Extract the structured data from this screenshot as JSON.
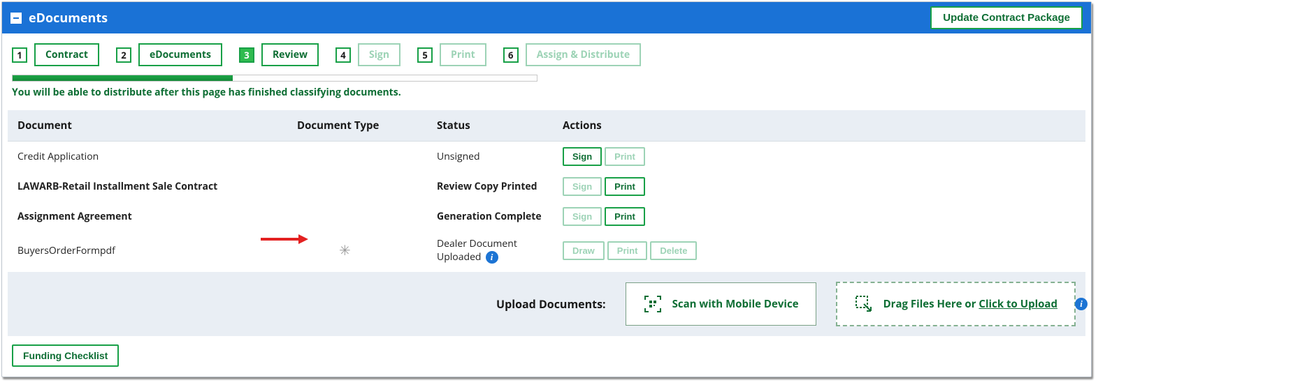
{
  "header": {
    "title": "eDocuments",
    "update_btn": "Update Contract Package"
  },
  "steps": [
    {
      "num": "1",
      "label": "Contract",
      "active": false,
      "faded": false
    },
    {
      "num": "2",
      "label": "eDocuments",
      "active": false,
      "faded": false
    },
    {
      "num": "3",
      "label": "Review",
      "active": true,
      "faded": false
    },
    {
      "num": "4",
      "label": "Sign",
      "active": false,
      "faded": true
    },
    {
      "num": "5",
      "label": "Print",
      "active": false,
      "faded": true
    },
    {
      "num": "6",
      "label": "Assign & Distribute",
      "active": false,
      "faded": true
    }
  ],
  "progress": {
    "percent": 42,
    "note": "You will be able to distribute after this page has finished classifying documents."
  },
  "table": {
    "headers": {
      "document": "Document",
      "doctype": "Document Type",
      "status": "Status",
      "actions": "Actions"
    },
    "rows": [
      {
        "name": "Credit Application",
        "name_bold": false,
        "doctype_spinner": false,
        "status": "Unsigned",
        "status_bold": false,
        "info": false,
        "actions": [
          {
            "label": "Sign",
            "faded": false
          },
          {
            "label": "Print",
            "faded": true
          }
        ]
      },
      {
        "name": "LAWARB-Retail Installment Sale Contract",
        "name_bold": true,
        "doctype_spinner": false,
        "status": "Review Copy Printed",
        "status_bold": true,
        "info": false,
        "actions": [
          {
            "label": "Sign",
            "faded": true
          },
          {
            "label": "Print",
            "faded": false
          }
        ]
      },
      {
        "name": "Assignment Agreement",
        "name_bold": true,
        "doctype_spinner": false,
        "status": "Generation Complete",
        "status_bold": true,
        "info": false,
        "actions": [
          {
            "label": "Sign",
            "faded": true
          },
          {
            "label": "Print",
            "faded": false
          }
        ]
      },
      {
        "name": "BuyersOrderFormpdf",
        "name_bold": false,
        "doctype_spinner": true,
        "arrow": true,
        "status": "Dealer Document Uploaded",
        "status_bold": false,
        "info": true,
        "actions": [
          {
            "label": "Draw",
            "faded": true
          },
          {
            "label": "Print",
            "faded": true
          },
          {
            "label": "Delete",
            "faded": true
          }
        ]
      }
    ]
  },
  "upload": {
    "label": "Upload Documents:",
    "scan_label": "Scan with Mobile Device",
    "drop_prefix": "Drag Files Here or ",
    "drop_click": "Click to Upload"
  },
  "footer": {
    "checklist_btn": "Funding Checklist"
  },
  "icons": {
    "collapse": "▪",
    "info": "i"
  }
}
